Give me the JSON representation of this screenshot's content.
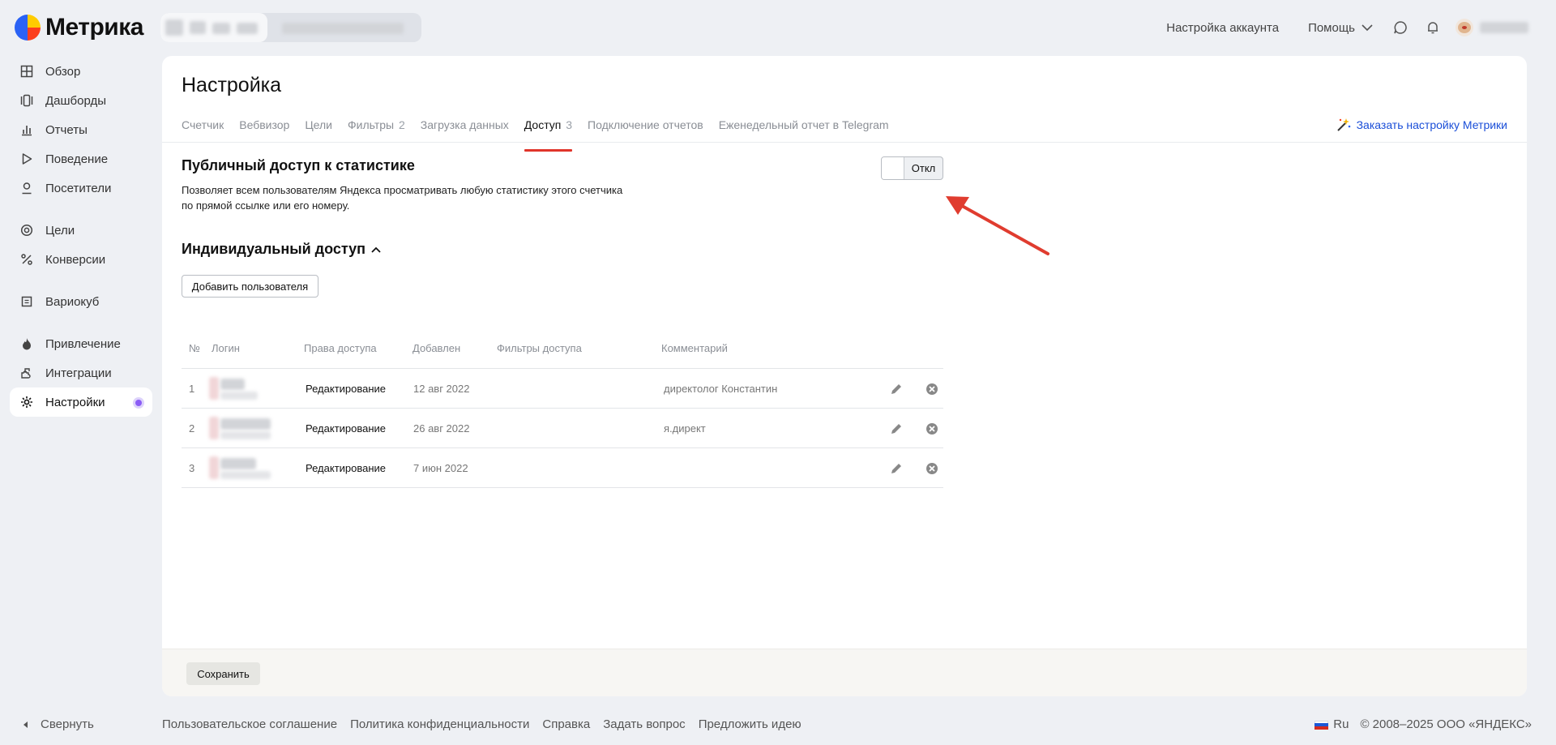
{
  "app": {
    "name": "Метрика"
  },
  "topnav": {
    "account_settings": "Настройка аккаунта",
    "help": "Помощь"
  },
  "sidebar": {
    "items": [
      {
        "label": "Обзор",
        "icon": "grid-icon"
      },
      {
        "label": "Дашборды",
        "icon": "dashboards-icon"
      },
      {
        "label": "Отчеты",
        "icon": "bar-chart-icon"
      },
      {
        "label": "Поведение",
        "icon": "play-icon"
      },
      {
        "label": "Посетители",
        "icon": "person-icon"
      },
      {
        "label": "Цели",
        "icon": "target-icon"
      },
      {
        "label": "Конверсии",
        "icon": "percent-icon"
      },
      {
        "label": "Вариокуб",
        "icon": "cube-icon"
      },
      {
        "label": "Привлечение",
        "icon": "flame-icon"
      },
      {
        "label": "Интеграции",
        "icon": "puzzle-icon"
      },
      {
        "label": "Настройки",
        "icon": "gear-icon",
        "active": true
      }
    ],
    "collapse": "Свернуть"
  },
  "page": {
    "title": "Настройка",
    "tabs": [
      {
        "label": "Счетчик",
        "count": ""
      },
      {
        "label": "Вебвизор",
        "count": ""
      },
      {
        "label": "Цели",
        "count": ""
      },
      {
        "label": "Фильтры",
        "count": "2"
      },
      {
        "label": "Загрузка данных",
        "count": ""
      },
      {
        "label": "Доступ",
        "count": "3",
        "active": true
      },
      {
        "label": "Подключение отчетов",
        "count": ""
      },
      {
        "label": "Еженедельный отчет в Telegram",
        "count": ""
      }
    ],
    "order_link": "Заказать настройку Метрики"
  },
  "public_access": {
    "title": "Публичный доступ к статистике",
    "description": "Позволяет всем пользователям Яндекса просматривать любую статистику этого счетчика по прямой ссылке или его номеру.",
    "toggle_label": "Откл",
    "enabled": false
  },
  "individual_access": {
    "title": "Индивидуальный доступ",
    "add_button": "Добавить пользователя",
    "columns": [
      "№",
      "Логин",
      "Права доступа",
      "Добавлен",
      "Фильтры доступа",
      "Комментарий"
    ],
    "rows": [
      {
        "num": "1",
        "rights": "Редактирование",
        "added": "12 авг 2022",
        "filters": "",
        "comment": "директолог Константин"
      },
      {
        "num": "2",
        "rights": "Редактирование",
        "added": "26 авг 2022",
        "filters": "",
        "comment": "я.директ"
      },
      {
        "num": "3",
        "rights": "Редактирование",
        "added": "7 июн 2022",
        "filters": "",
        "comment": ""
      }
    ]
  },
  "save_button": "Сохранить",
  "footer": {
    "links": [
      "Пользовательское соглашение",
      "Политика конфиденциальности",
      "Справка",
      "Задать вопрос",
      "Предложить идею"
    ],
    "lang": "Ru",
    "copyright": "© 2008–2025 ООО «ЯНДЕКС»"
  },
  "colors": {
    "accent_red": "#e0342a",
    "link_blue": "#1a4ed8",
    "active_dot": "#8b5cf6"
  }
}
